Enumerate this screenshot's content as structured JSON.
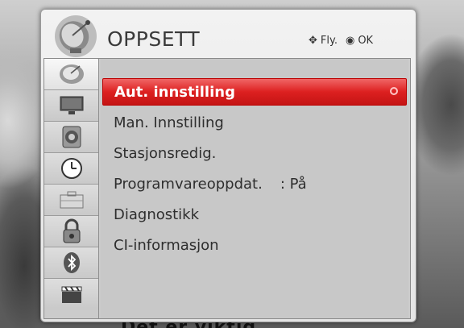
{
  "title": "OPPSETT",
  "hint": {
    "nav_label": "Fly.",
    "ok_label": "OK",
    "nav_icon": "arrows-icon",
    "ok_icon": "ok-circle-icon"
  },
  "tabs": [
    {
      "icon": "satellite-dish-icon",
      "active": true
    },
    {
      "icon": "monitor-icon",
      "active": false
    },
    {
      "icon": "speaker-icon",
      "active": false
    },
    {
      "icon": "clock-icon",
      "active": false
    },
    {
      "icon": "toolbox-icon",
      "active": false
    },
    {
      "icon": "lock-icon",
      "active": false
    },
    {
      "icon": "bluetooth-icon",
      "active": false
    },
    {
      "icon": "clapperboard-icon",
      "active": false
    }
  ],
  "menu": {
    "items": [
      {
        "label": "Aut. innstilling",
        "selected": true
      },
      {
        "label": "Man. Innstilling"
      },
      {
        "label": "Stasjonsredig."
      },
      {
        "label": "Programvareoppdat.",
        "value": ": På"
      },
      {
        "label": "Diagnostikk"
      },
      {
        "label": "CI-informasjon"
      }
    ]
  },
  "background_subtitle": "Det er viktig",
  "colors": {
    "highlight": "#dd2020",
    "panel": "#e8e8e8"
  }
}
